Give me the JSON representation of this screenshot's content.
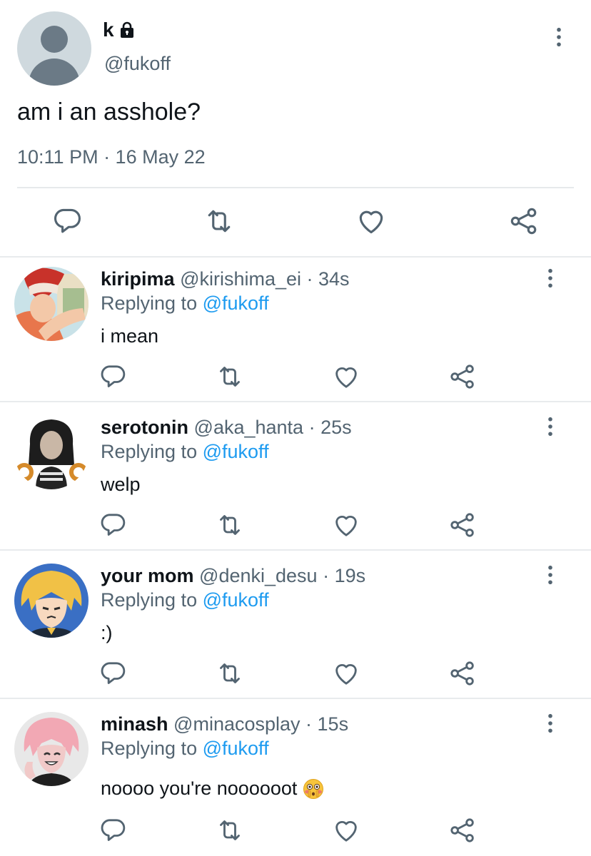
{
  "main_tweet": {
    "name": "k",
    "locked_icon": "lock-icon",
    "handle": "@fukoff",
    "text": "am i an asshole?",
    "timestamp": "10:11 PM · 16 May 22",
    "actions": [
      "reply-icon",
      "retweet-icon",
      "like-icon",
      "share-icon"
    ]
  },
  "replies": [
    {
      "name": "kiripima",
      "handle": "@kirishima_ei",
      "time": "· 34s",
      "replying_prefix": "Replying to",
      "replying_to": "@fukoff",
      "text": "i mean"
    },
    {
      "name": "serotonin",
      "handle": "@aka_hanta",
      "time": "· 25s",
      "replying_prefix": "Replying to",
      "replying_to": "@fukoff",
      "text": "welp"
    },
    {
      "name": "your mom",
      "handle": "@denki_desu",
      "time": "· 19s",
      "replying_prefix": "Replying to",
      "replying_to": "@fukoff",
      "text": ":)"
    },
    {
      "name": "minash",
      "handle": "@minacosplay",
      "time": "· 15s",
      "replying_prefix": "Replying to",
      "replying_to": "@fukoff",
      "text": "noooo you're noooooot",
      "emoji": "flushed-face-emoji"
    }
  ],
  "colors": {
    "link": "#1d9bf0",
    "muted": "#536471",
    "text": "#0f1419",
    "divider": "#e8ebed"
  }
}
